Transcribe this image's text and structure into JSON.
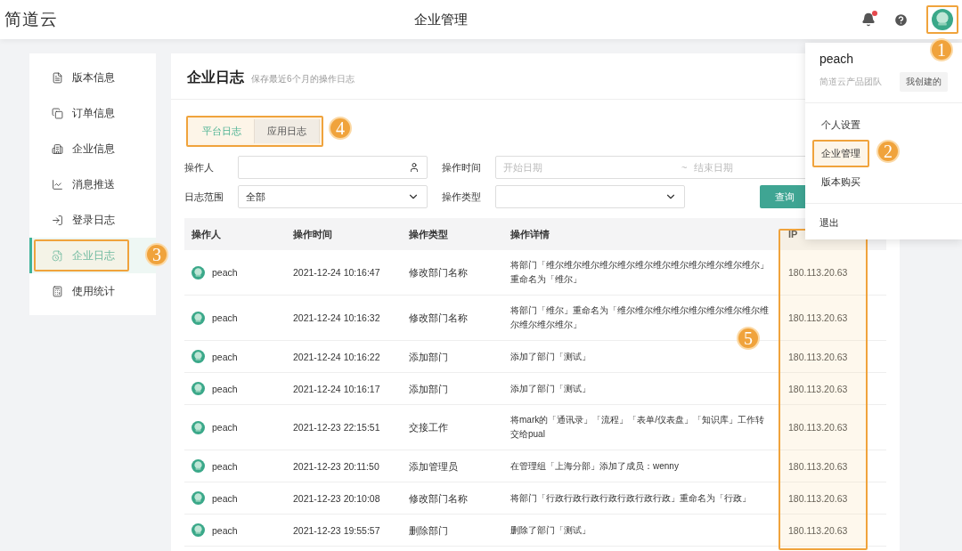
{
  "header": {
    "logo": "简道云",
    "title": "企业管理",
    "unread": true,
    "avatar_callout": "1"
  },
  "sidebar": {
    "items": [
      {
        "label": "版本信息",
        "selected": false
      },
      {
        "label": "订单信息",
        "selected": false
      },
      {
        "label": "企业信息",
        "selected": false
      },
      {
        "label": "消息推送",
        "selected": false
      },
      {
        "label": "登录日志",
        "selected": false
      },
      {
        "label": "企业日志",
        "selected": true,
        "callout": "3"
      },
      {
        "label": "使用统计",
        "selected": false
      }
    ]
  },
  "page": {
    "title": "企业日志",
    "subtitle": "保存最近6个月的操作日志"
  },
  "tabs": {
    "callout": "4",
    "items": [
      {
        "label": "平台日志",
        "selected": true
      },
      {
        "label": "应用日志",
        "selected": false
      }
    ]
  },
  "filters": {
    "operator_label": "操作人",
    "time_label": "操作时间",
    "start_placeholder": "开始日期",
    "range_sep": "~",
    "end_placeholder": "结束日期",
    "scope_label": "日志范围",
    "scope_value": "全部",
    "type_label": "操作类型",
    "query_button": "查询"
  },
  "table": {
    "columns": [
      {
        "label": "操作人"
      },
      {
        "label": "操作时间"
      },
      {
        "label": "操作类型"
      },
      {
        "label": "操作详情"
      },
      {
        "label": "IP",
        "callout": "5"
      }
    ],
    "rows": [
      {
        "operator": "peach",
        "time": "2021-12-24 10:16:47",
        "type": "修改部门名称",
        "detail": "将部门「维尔维尔维尔维尔维尔维尔维尔维尔维尔维尔维尔维尔」重命名为「维尔」",
        "ip": "180.113.20.63"
      },
      {
        "operator": "peach",
        "time": "2021-12-24 10:16:32",
        "type": "修改部门名称",
        "detail": "将部门「维尔」重命名为「维尔维尔维尔维尔维尔维尔维尔维尔维尔维尔维尔维尔」",
        "ip": "180.113.20.63"
      },
      {
        "operator": "peach",
        "time": "2021-12-24 10:16:22",
        "type": "添加部门",
        "detail": "添加了部门「测试」",
        "ip": "180.113.20.63"
      },
      {
        "operator": "peach",
        "time": "2021-12-24 10:16:17",
        "type": "添加部门",
        "detail": "添加了部门「测试」",
        "ip": "180.113.20.63"
      },
      {
        "operator": "peach",
        "time": "2021-12-23 22:15:51",
        "type": "交接工作",
        "detail": "将mark的「通讯录」「流程」「表单/仪表盘」「知识库」工作转交给pual",
        "ip": "180.113.20.63"
      },
      {
        "operator": "peach",
        "time": "2021-12-23 20:11:50",
        "type": "添加管理员",
        "detail": "在管理组「上海分部」添加了成员：wenny",
        "ip": "180.113.20.63"
      },
      {
        "operator": "peach",
        "time": "2021-12-23 20:10:08",
        "type": "修改部门名称",
        "detail": "将部门「行政行政行政行政行政行政行政」重命名为「行政」",
        "ip": "180.113.20.63"
      },
      {
        "operator": "peach",
        "time": "2021-12-23 19:55:57",
        "type": "删除部门",
        "detail": "删除了部门「测试」",
        "ip": "180.113.20.63"
      }
    ]
  },
  "user_menu": {
    "name": "peach",
    "team": "简道云产品团队",
    "tag": "我创建的",
    "items": [
      {
        "label": "个人设置"
      },
      {
        "label": "企业管理",
        "callout": "2"
      },
      {
        "label": "版本购买"
      }
    ],
    "logout": "退出"
  }
}
